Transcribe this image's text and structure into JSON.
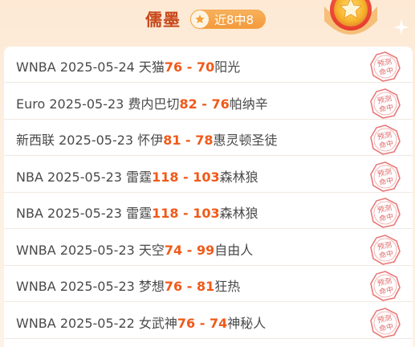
{
  "header": {
    "expert_name": "儒墨",
    "record": "近8中8",
    "badge_star_icon": "star-icon",
    "medal_icon": "gold-medal-star-icon",
    "accent_color": "#c8491b",
    "score_color": "#f05a1a"
  },
  "stamp_text": "预测命中",
  "matches": [
    {
      "league": "WNBA",
      "date": "2025-05-24",
      "home": "天猫",
      "home_score": "76",
      "sep": " - ",
      "away_score": "70",
      "away": "阳光"
    },
    {
      "league": "Euro",
      "date": "2025-05-23",
      "home": "费内巴切",
      "home_score": "82",
      "sep": " - ",
      "away_score": "76",
      "away": "帕纳辛"
    },
    {
      "league": "新西联",
      "date": "2025-05-23",
      "home": "怀伊",
      "home_score": "81",
      "sep": " - ",
      "away_score": "78",
      "away": "惠灵顿圣徒"
    },
    {
      "league": "NBA",
      "date": "2025-05-23",
      "home": "雷霆",
      "home_score": "118",
      "sep": " - ",
      "away_score": "103",
      "away": "森林狼"
    },
    {
      "league": "NBA",
      "date": "2025-05-23",
      "home": "雷霆",
      "home_score": "118",
      "sep": " - ",
      "away_score": "103",
      "away": "森林狼"
    },
    {
      "league": "WNBA",
      "date": "2025-05-23",
      "home": "天空",
      "home_score": "74",
      "sep": " - ",
      "away_score": "99",
      "away": "自由人"
    },
    {
      "league": "WNBA",
      "date": "2025-05-23",
      "home": "梦想",
      "home_score": "76",
      "sep": " - ",
      "away_score": "81",
      "away": "狂热"
    },
    {
      "league": "WNBA",
      "date": "2025-05-22",
      "home": "女武神",
      "home_score": "76",
      "sep": " - ",
      "away_score": "74",
      "away": "神秘人"
    }
  ]
}
